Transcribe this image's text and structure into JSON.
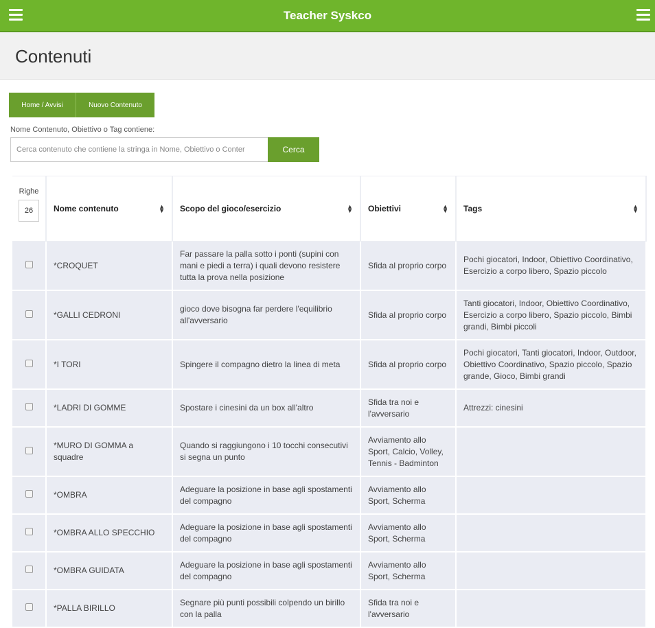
{
  "app": {
    "title": "Teacher Syskco"
  },
  "page": {
    "title": "Contenuti"
  },
  "nav_buttons": {
    "home": "Home / Avvisi",
    "new": "Nuovo Contenuto"
  },
  "search": {
    "label": "Nome Contenuto, Obiettivo o Tag contiene:",
    "placeholder": "Cerca contenuto che contiene la stringa in Nome, Obiettivo o Conter",
    "button": "Cerca"
  },
  "table": {
    "righe_label": "Righe",
    "righe_value": "26",
    "headers": {
      "nome": "Nome contenuto",
      "scopo": "Scopo del gioco/esercizio",
      "obiettivi": "Obiettivi",
      "tags": "Tags"
    },
    "rows": [
      {
        "nome": "*CROQUET",
        "scopo": "Far passare la palla sotto i ponti (supini con mani e piedi a terra) i quali devono resistere tutta la prova nella posizione",
        "obiettivi": "Sfida al proprio corpo",
        "tags": "Pochi giocatori, Indoor, Obiettivo Coordinativo, Esercizio a corpo libero, Spazio piccolo"
      },
      {
        "nome": "*GALLI CEDRONI",
        "scopo": "gioco dove bisogna far perdere l'equilibrio all'avversario",
        "obiettivi": "Sfida al proprio corpo",
        "tags": "Tanti giocatori, Indoor, Obiettivo Coordinativo, Esercizio a corpo libero, Spazio piccolo, Bimbi grandi, Bimbi piccoli"
      },
      {
        "nome": "*I TORI",
        "scopo": "Spingere il compagno dietro la linea di meta",
        "obiettivi": "Sfida al proprio corpo",
        "tags": "Pochi giocatori, Tanti giocatori, Indoor, Outdoor, Obiettivo Coordinativo, Spazio piccolo, Spazio grande, Gioco, Bimbi grandi"
      },
      {
        "nome": "*LADRI DI GOMME",
        "scopo": "Spostare i cinesini da un box all'altro",
        "obiettivi": "Sfida tra noi e l'avversario",
        "tags": "Attrezzi: cinesini"
      },
      {
        "nome": "*MURO DI GOMMA a squadre",
        "scopo": "Quando si raggiungono i 10 tocchi consecutivi si segna un punto",
        "obiettivi": "Avviamento allo Sport, Calcio, Volley, Tennis - Badminton",
        "tags": ""
      },
      {
        "nome": "*OMBRA",
        "scopo": "Adeguare la posizione in base agli spostamenti del compagno",
        "obiettivi": "Avviamento allo Sport, Scherma",
        "tags": ""
      },
      {
        "nome": "*OMBRA ALLO SPECCHIO",
        "scopo": "Adeguare la posizione in base agli spostamenti del compagno",
        "obiettivi": "Avviamento allo Sport, Scherma",
        "tags": ""
      },
      {
        "nome": "*OMBRA GUIDATA",
        "scopo": "Adeguare la posizione in base agli spostamenti del compagno",
        "obiettivi": "Avviamento allo Sport, Scherma",
        "tags": ""
      },
      {
        "nome": "*PALLA BIRILLO",
        "scopo": "Segnare più punti possibili colpendo un birillo con la palla",
        "obiettivi": "Sfida tra noi e l'avversario",
        "tags": ""
      }
    ]
  },
  "icons": {
    "menu": "hamburger-menu-icon",
    "sort": "sort-icon",
    "checkbox": "checkbox"
  },
  "colors": {
    "primary_green": "#6fb52c",
    "button_green": "#6a9f2d",
    "row_bg": "#eaecf3"
  }
}
